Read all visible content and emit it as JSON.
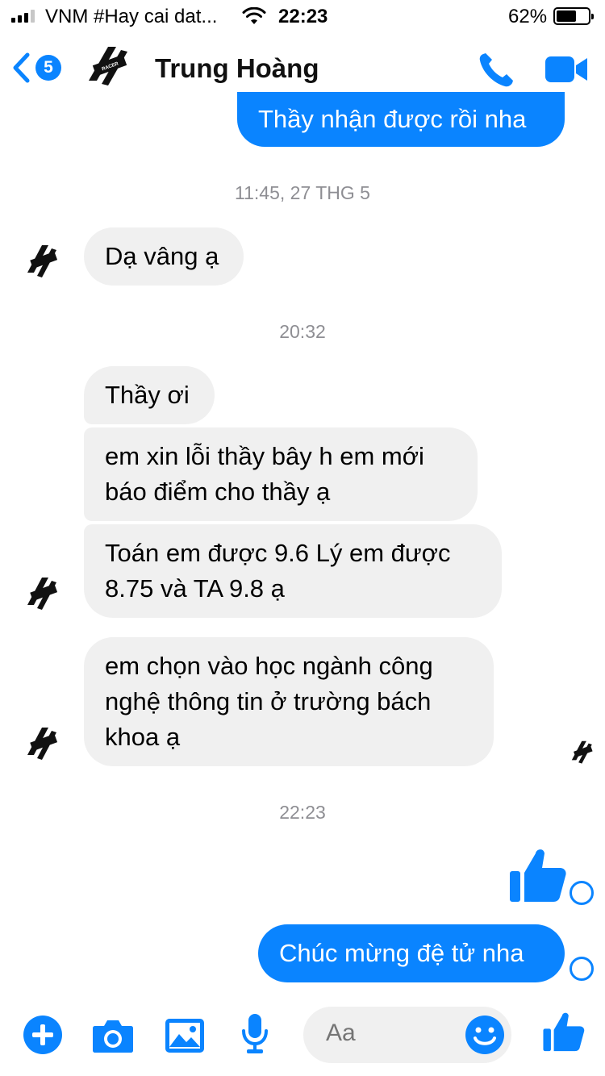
{
  "status_bar": {
    "carrier": "VNM #Hay cai dat...",
    "time": "22:23",
    "battery_percent": "62%",
    "battery_level": 0.62,
    "signal_bars": 3
  },
  "header": {
    "back_badge": "5",
    "contact_name": "Trung Hoàng",
    "avatar_text": "RACER"
  },
  "messages": {
    "out_top": "Thầy nhận được rồi nha",
    "ts1": "11:45, 27 THG 5",
    "in1": "Dạ vâng ạ",
    "ts2": "20:32",
    "in2": "Thầy ơi",
    "in3_line1": "em xin lỗi thầy bây h em mới",
    "in3_line2": "báo điểm cho thầy ạ",
    "in4_line1": "Toán em được 9.6 Lý em được",
    "in4_line2": "8.75 và TA 9.8 ạ",
    "in5_line1": "em chọn vào học ngành công",
    "in5_line2": "nghệ thông tin ở trường bách",
    "in5_line3": "khoa ạ",
    "ts3": "22:23",
    "out_last": "Chúc mừng đệ tử nha"
  },
  "composer": {
    "placeholder": "Aa"
  },
  "icons": {
    "back": "chevron-left-icon",
    "call": "phone-icon",
    "video": "video-camera-icon",
    "add": "plus-circle-icon",
    "camera": "camera-icon",
    "gallery": "image-icon",
    "mic": "microphone-icon",
    "emoji": "smiley-icon",
    "like": "thumbs-up-icon"
  },
  "colors": {
    "accent": "#0a84ff",
    "bubble_in": "#f0f0f0",
    "timestamp": "#8e8e93"
  }
}
